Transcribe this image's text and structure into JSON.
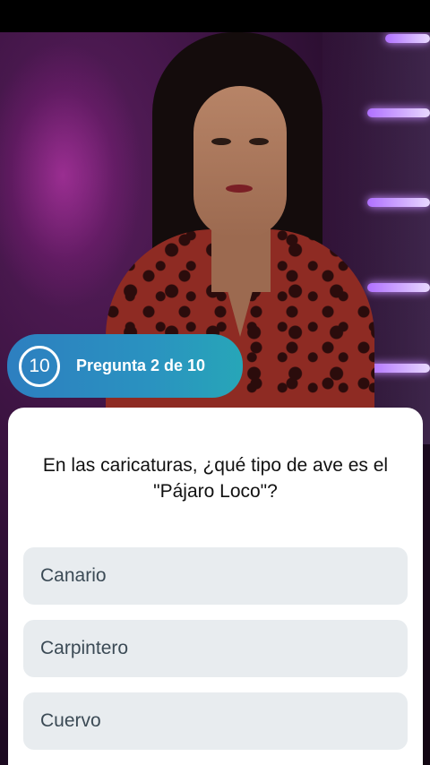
{
  "header": {
    "timer": "10",
    "question_counter": "Pregunta 2 de 10"
  },
  "quiz": {
    "question": "En las caricaturas, ¿qué tipo de ave es el \"Pájaro Loco\"?",
    "answers": [
      {
        "label": "Canario"
      },
      {
        "label": "Carpintero"
      },
      {
        "label": "Cuervo"
      }
    ]
  },
  "colors": {
    "pill_gradient_start": "#2d7fc0",
    "pill_gradient_end": "#27a6b8",
    "card_background": "#ffffff",
    "answer_background": "#e8ecef",
    "answer_text": "#3b4a55"
  },
  "video": {
    "description_icon": "presenter-video"
  }
}
